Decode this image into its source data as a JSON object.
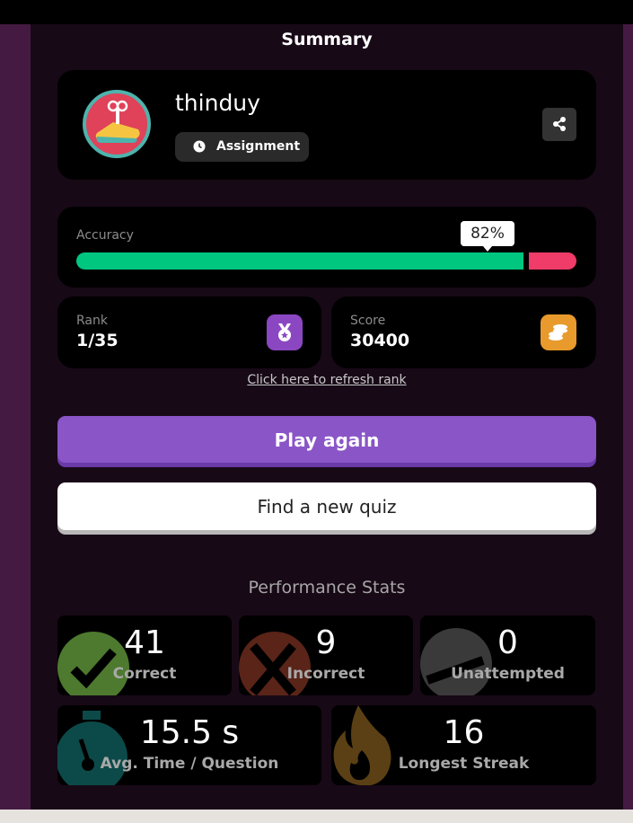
{
  "page": {
    "title": "Summary"
  },
  "profile": {
    "username": "thinduy",
    "mode_label": "Assignment",
    "avatar_icon": "shoe-key-icon",
    "share_icon": "share-icon"
  },
  "accuracy": {
    "label": "Accuracy",
    "percent_text": "82%",
    "percent": 82,
    "correct_color": "#00c780",
    "incorrect_color": "#ef3c69"
  },
  "rank": {
    "label": "Rank",
    "value": "1/35",
    "icon": "medal-icon"
  },
  "score": {
    "label": "Score",
    "value": "30400",
    "icon": "coins-icon"
  },
  "refresh_link": "Click here to refresh rank",
  "buttons": {
    "play_again": "Play again",
    "find_quiz": "Find a new quiz"
  },
  "performance": {
    "title": "Performance Stats",
    "correct": {
      "value": "41",
      "label": "Correct",
      "icon": "check-icon",
      "color": "#4d7a2e"
    },
    "incorrect": {
      "value": "9",
      "label": "Incorrect",
      "icon": "cross-icon",
      "color": "#5a2418"
    },
    "unattempted": {
      "value": "0",
      "label": "Unattempted",
      "icon": "minus-icon",
      "color": "#3a3a3a"
    },
    "avg_time": {
      "value": "15.5 s",
      "label": "Avg. Time / Question",
      "icon": "stopwatch-icon",
      "color": "#0c4a49"
    },
    "streak": {
      "value": "16",
      "label": "Longest Streak",
      "icon": "flame-icon",
      "color": "#5a4014"
    }
  }
}
